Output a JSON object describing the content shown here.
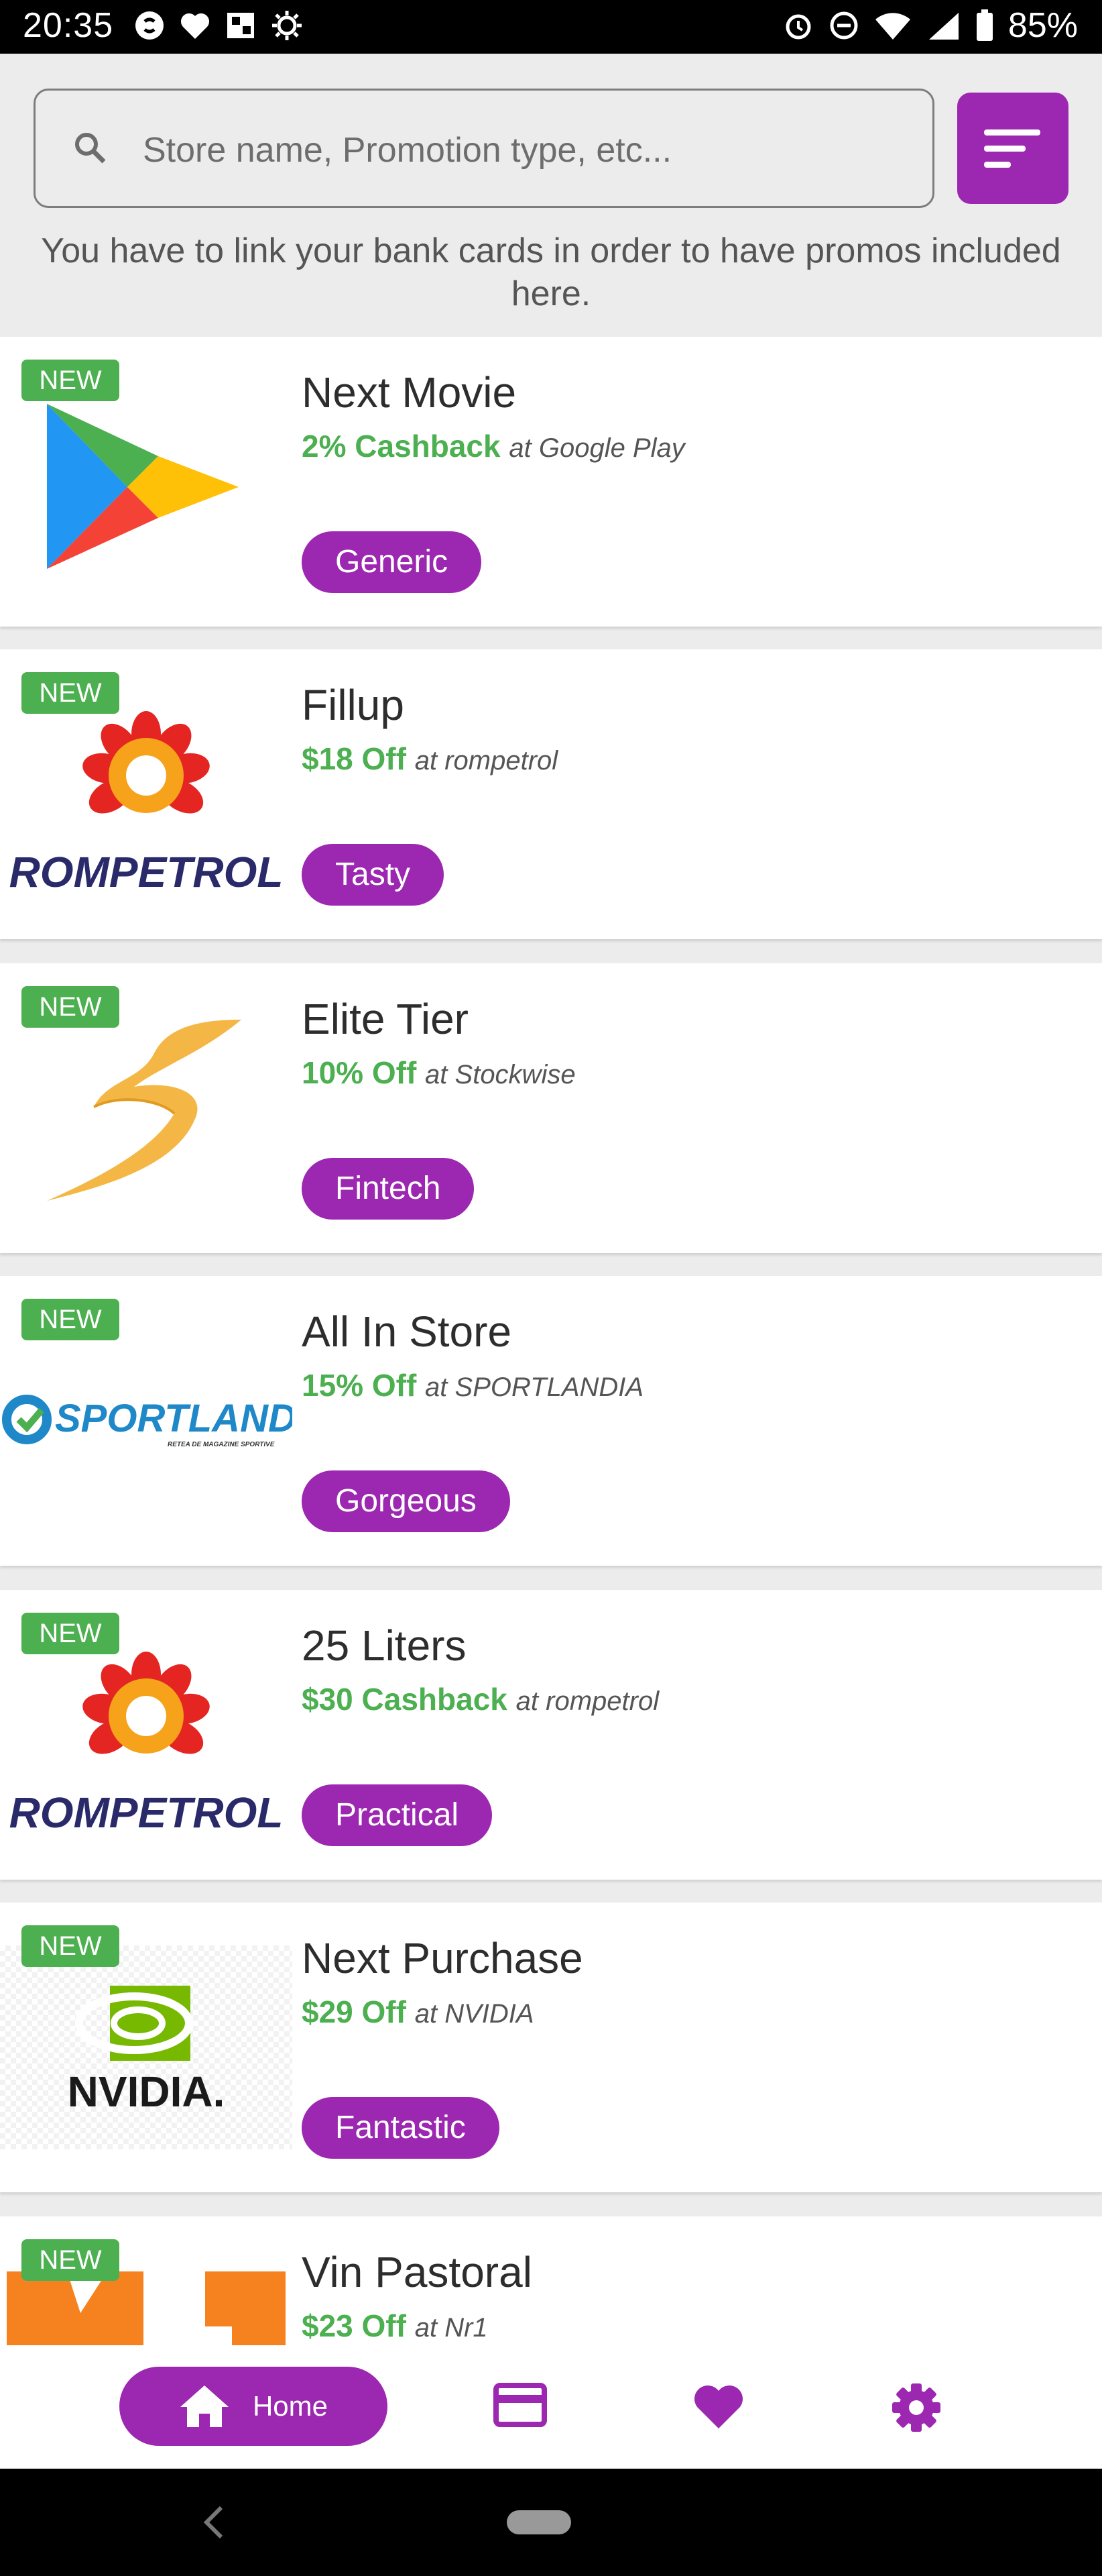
{
  "status_bar": {
    "time": "20:35",
    "battery": "85%"
  },
  "search": {
    "placeholder": "Store name, Promotion type, etc..."
  },
  "notice": "You have to link your bank cards in order to have promos included here.",
  "promos": [
    {
      "badge": "NEW",
      "title": "Next Movie",
      "offer": "2% Cashback",
      "at": "at Google Play",
      "tag": "Generic",
      "logo": "google-play-logo"
    },
    {
      "badge": "NEW",
      "title": "Fillup",
      "offer": "$18 Off",
      "at": "at rompetrol",
      "tag": "Tasty",
      "logo": "rompetrol-logo",
      "logo_text": "ROMPETROL"
    },
    {
      "badge": "NEW",
      "title": "Elite Tier",
      "offer": "10% Off",
      "at": "at Stockwise",
      "tag": "Fintech",
      "logo": "stockwise-logo"
    },
    {
      "badge": "NEW",
      "title": "All In Store",
      "offer": "15% Off",
      "at": "at SPORTLANDIA",
      "tag": "Gorgeous",
      "logo": "sportlandia-logo",
      "logo_text": "SPORTLANDIA",
      "logo_subtext": "RETEA DE MAGAZINE SPORTIVE"
    },
    {
      "badge": "NEW",
      "title": "25 Liters",
      "offer": "$30 Cashback",
      "at": "at rompetrol",
      "tag": "Practical",
      "logo": "rompetrol-logo",
      "logo_text": "ROMPETROL"
    },
    {
      "badge": "NEW",
      "title": "Next Purchase",
      "offer": "$29 Off",
      "at": "at NVIDIA",
      "tag": "Fantastic",
      "logo": "nvidia-logo",
      "logo_text": "NVIDIA."
    },
    {
      "badge": "NEW",
      "title": "Vin Pastoral",
      "offer": "$23 Off",
      "at": "at Nr1",
      "tag": "",
      "logo": "nr1-logo"
    }
  ],
  "bottom_nav": {
    "home_label": "Home",
    "items": [
      "home-icon",
      "card-icon",
      "heart-icon",
      "gear-icon"
    ]
  },
  "colors": {
    "accent": "#9c27b0",
    "new_badge": "#4caf50",
    "offer_text": "#4caf50"
  }
}
